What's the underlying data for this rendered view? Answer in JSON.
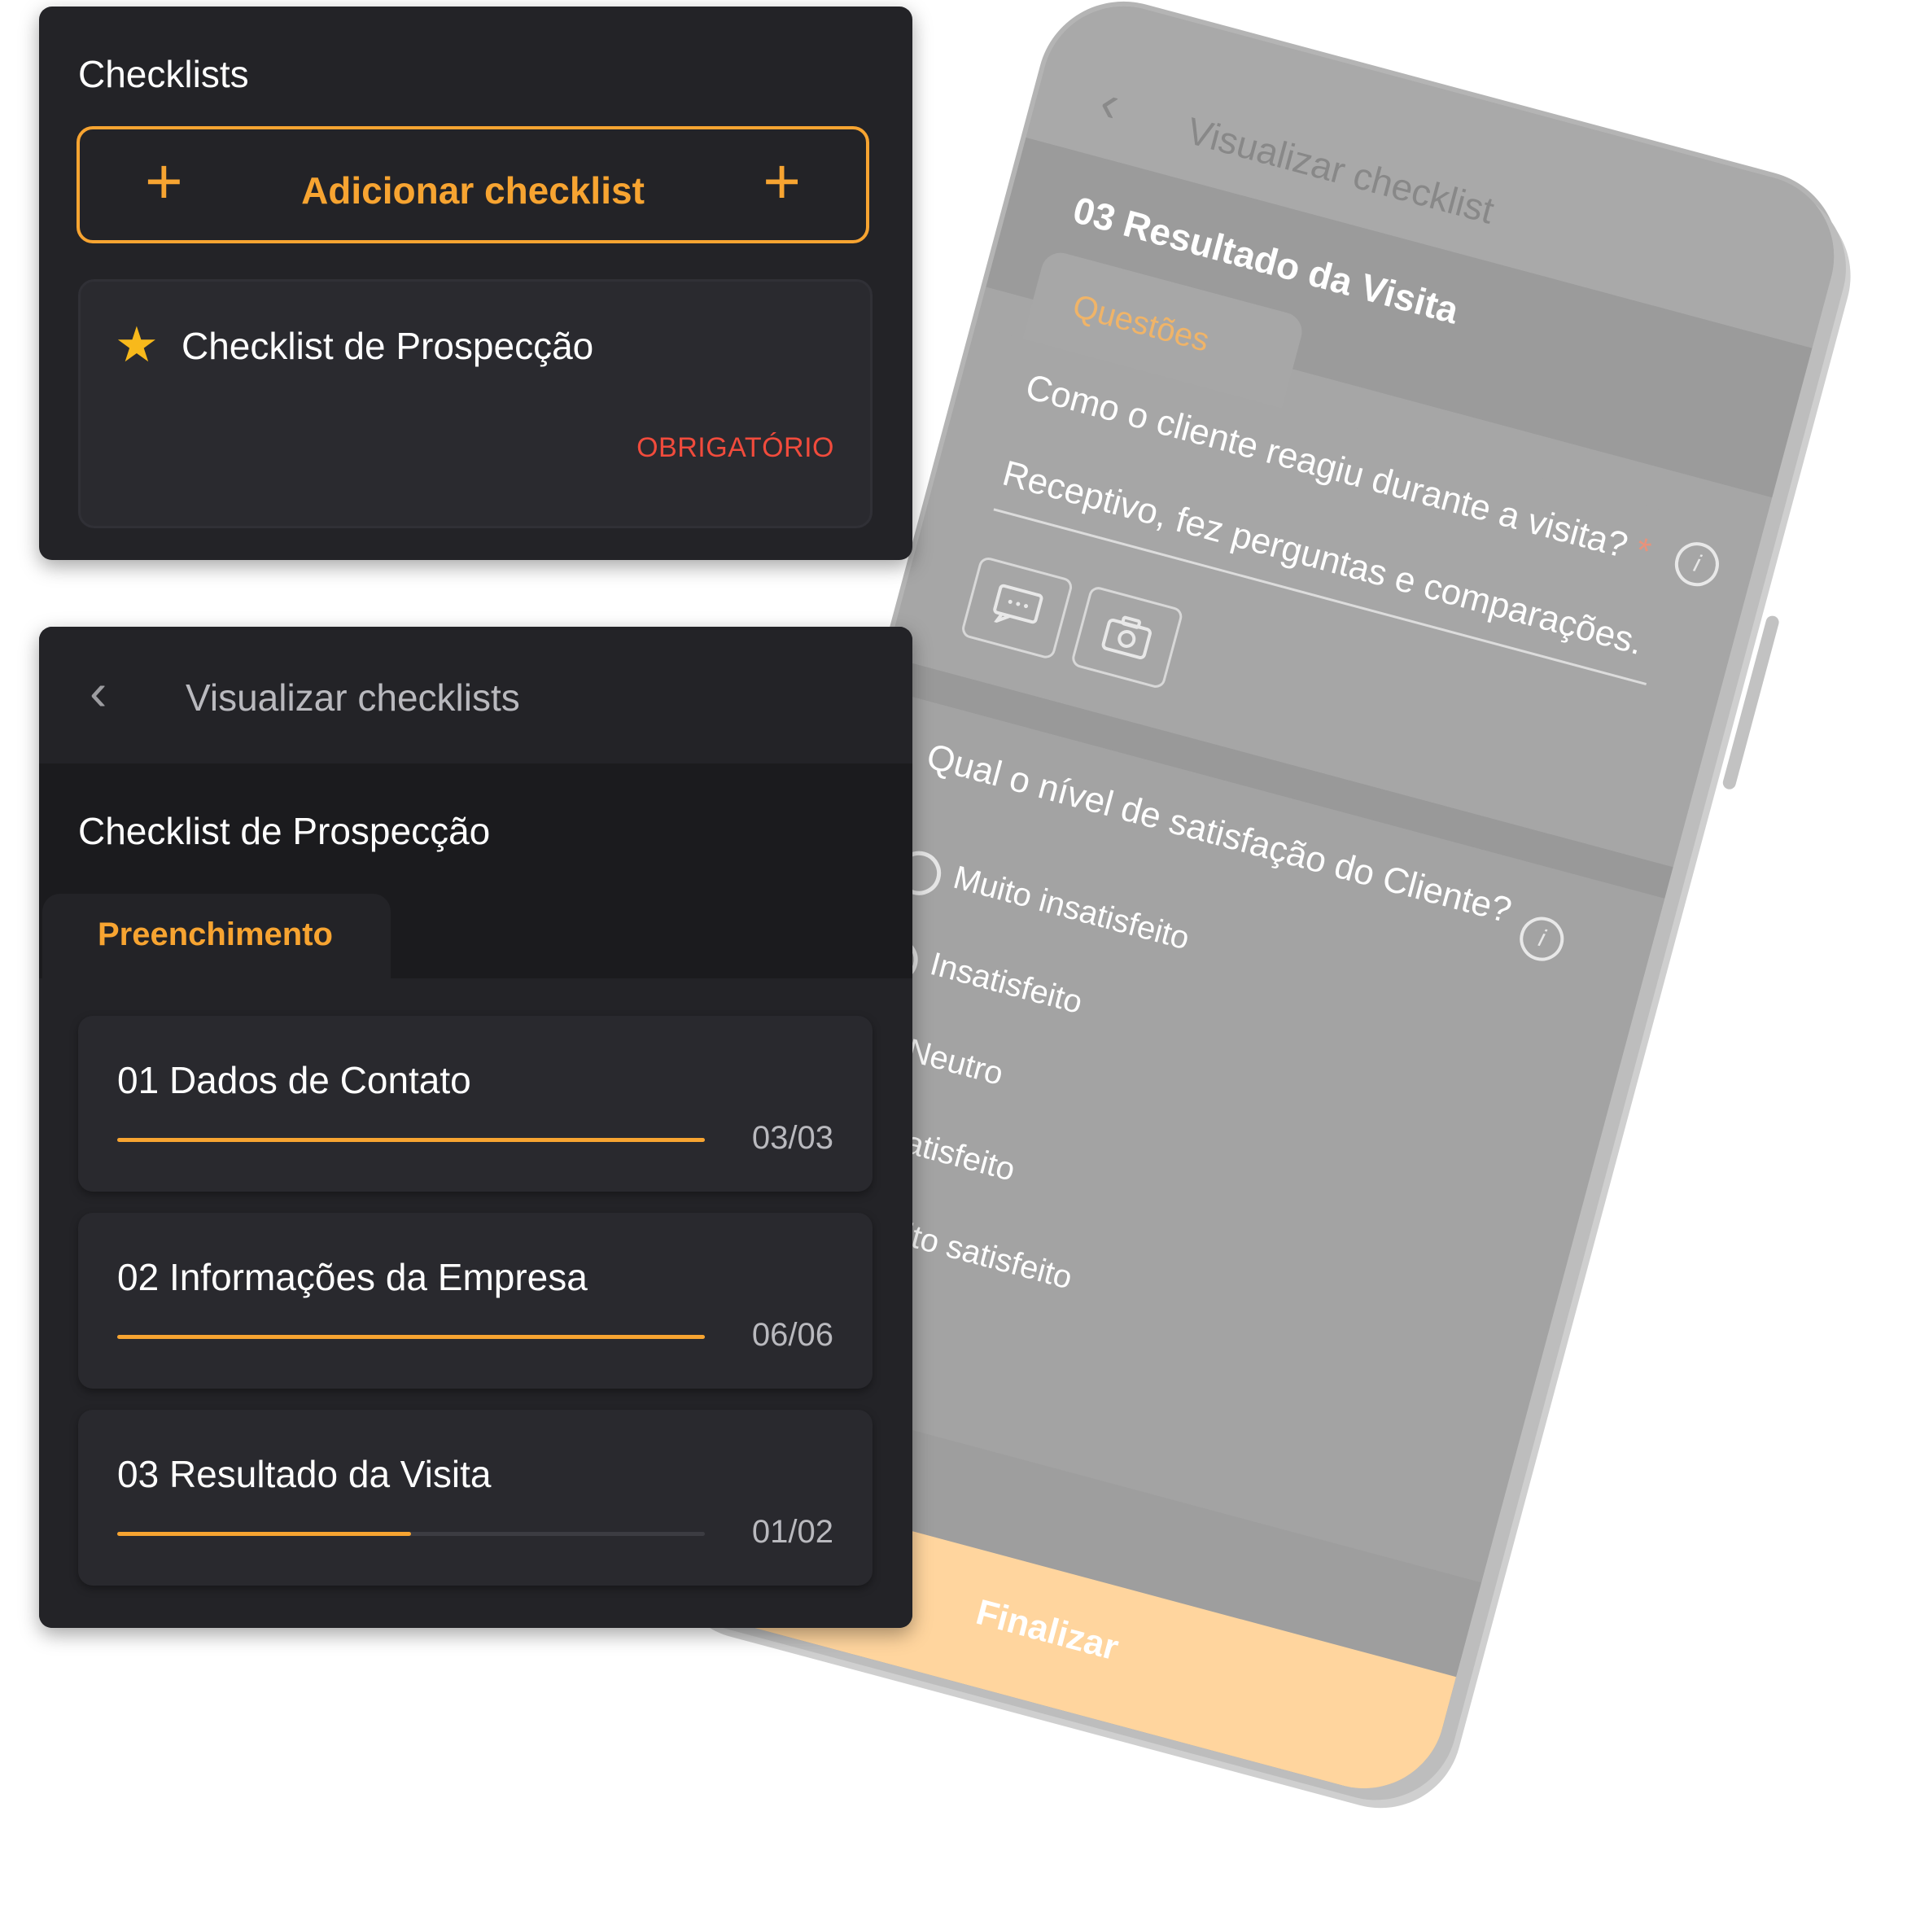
{
  "checklists_panel": {
    "title": "Checklists",
    "add_button_label": "Adicionar checklist",
    "items": [
      {
        "name": "Checklist de Prospecção",
        "badge": "OBRIGATÓRIO",
        "favorite": true
      }
    ]
  },
  "view_panel": {
    "header_title": "Visualizar checklists",
    "checklist_title": "Checklist de Prospecção",
    "tab_label": "Preenchimento",
    "sections": [
      {
        "name": "01 Dados de Contato",
        "progress_text": "03/03",
        "progress": 1.0
      },
      {
        "name": "02 Informações da Empresa",
        "progress_text": "06/06",
        "progress": 1.0
      },
      {
        "name": "03 Resultado da Visita",
        "progress_text": "01/02",
        "progress": 0.5
      }
    ]
  },
  "phone": {
    "header_title": "Visualizar checklist",
    "section_title": "03 Resultado da Visita",
    "tab_label": "Questões",
    "question1": "Como o cliente reagiu durante a visita?",
    "question1_required_mark": "*",
    "answer1": "Receptivo, fez perguntas e comparações.",
    "question2": "Qual o nível de satisfação do Cliente?",
    "options": [
      "Muito insatisfeito",
      "Insatisfeito",
      "Neutro",
      "Satisfeito",
      "Muito satisfeito"
    ],
    "finalize_label": "Finalizar"
  },
  "colors": {
    "accent": "#f7a431",
    "required_badge": "#f14b3c",
    "star": "#f8b91b",
    "card_bg": "#232327",
    "finalize_bg": "#ffd59e"
  },
  "icons": [
    "plus-icon",
    "star-icon",
    "chevron-left-icon",
    "info-icon",
    "comment-icon",
    "camera-icon",
    "radio-icon"
  ]
}
